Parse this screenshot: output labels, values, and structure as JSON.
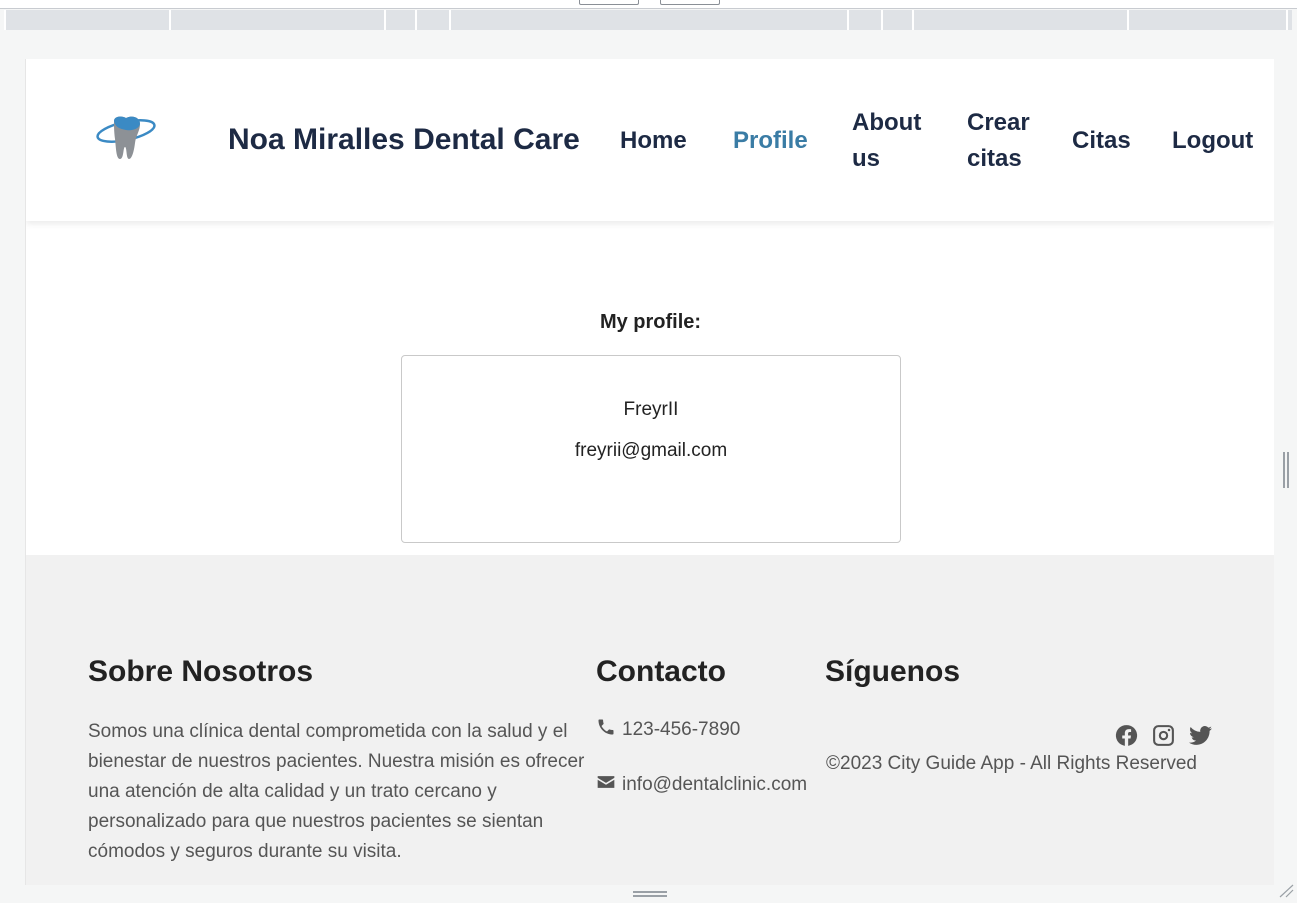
{
  "header": {
    "brand": "Noa Miralles Dental Care",
    "nav": [
      {
        "label": "Home",
        "active": false
      },
      {
        "label": "Profile",
        "active": true
      },
      {
        "label": "About us",
        "lines": [
          "About",
          "us"
        ],
        "active": false
      },
      {
        "label": "Crear citas",
        "lines": [
          "Crear",
          "citas"
        ],
        "active": false
      },
      {
        "label": "Citas",
        "active": false
      },
      {
        "label": "Logout",
        "active": false
      }
    ]
  },
  "profile": {
    "title": "My profile:",
    "username": "FreyrII",
    "email": "freyrii@gmail.com"
  },
  "footer": {
    "about": {
      "title": "Sobre Nosotros",
      "text": "Somos una clínica dental comprometida con la salud y el bienestar de nuestros pacientes. Nuestra misión es ofrecer una atención de alta calidad y un trato cercano y personalizado para que nuestros pacientes se sientan cómodos y seguros durante su visita."
    },
    "contact": {
      "title": "Contacto",
      "phone": "123-456-7890",
      "email": "info@dentalclinic.com"
    },
    "social": {
      "title": "Síguenos",
      "icons": [
        "facebook-icon",
        "instagram-icon",
        "twitter-icon"
      ],
      "copyright": "©2023 City Guide App - All Rights Reserved"
    }
  },
  "colors": {
    "brand_text": "#1d2a44",
    "active_link": "#3a7ca5",
    "footer_bg": "#f1f1f1",
    "logo_blue": "#3b8ac4"
  }
}
